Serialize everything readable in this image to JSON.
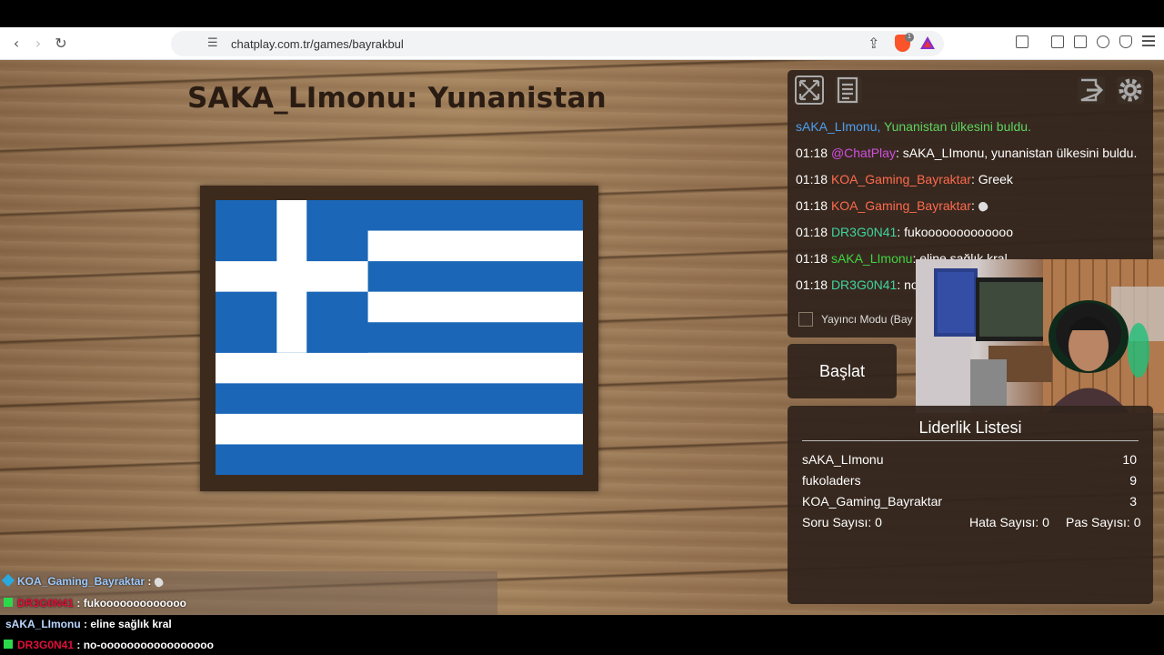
{
  "browser": {
    "url": "chatplay.com.tr/games/bayrakbul",
    "brave_badge": "1"
  },
  "game": {
    "title": "SAKA_LImonu: Yunanistan",
    "flag": "greece"
  },
  "chat": {
    "lines": [
      {
        "time": "",
        "user": "sAKA_LImonu,",
        "text": " Yunanistan ülkesini buldu.",
        "user_color": "#4a9ff0",
        "text_color": "#5fd45f"
      },
      {
        "time": "01:18 ",
        "user": "@ChatPlay",
        "text": ": sAKA_LImonu, yunanistan ülkesini buldu.",
        "user_color": "#d14fe0",
        "text_color": "#ffffff"
      },
      {
        "time": "01:18 ",
        "user": "KOA_Gaming_Bayraktar",
        "text": ": Greek",
        "user_color": "#ff6a4d",
        "text_color": "#ffffff"
      },
      {
        "time": "01:18 ",
        "user": "KOA_Gaming_Bayraktar",
        "text": ": ",
        "user_color": "#ff6a4d",
        "text_color": "#ffffff"
      },
      {
        "time": "01:18 ",
        "user": "DR3G0N41",
        "text": ": fukooooooooooooo",
        "user_color": "#3fd4a0",
        "text_color": "#ffffff"
      },
      {
        "time": "01:18 ",
        "user": "sAKA_LImonu",
        "text": ": eline sağlık kral",
        "user_color": "#3fd43f",
        "text_color": "#ffffff"
      },
      {
        "time": "01:18 ",
        "user": "DR3G0N41",
        "text": ": no-",
        "user_color": "#3fd4a0",
        "text_color": "#ffffff"
      }
    ],
    "streamer_mode_label": "Yayıncı Modu (Bay"
  },
  "controls": {
    "start_label": "Başlat"
  },
  "leaderboard": {
    "title": "Liderlik Listesi",
    "entries": [
      {
        "name": "sAKA_LImonu",
        "score": "10"
      },
      {
        "name": "fukoladers",
        "score": "9"
      },
      {
        "name": "KOA_Gaming_Bayraktar",
        "score": "3"
      }
    ],
    "question_count": "Soru Sayısı: 0",
    "error_count": "Hata Sayısı: 0",
    "pass_count": "Pas Sayısı: 0"
  },
  "overlay": {
    "lines": [
      {
        "user": "KOA_Gaming_Bayraktar",
        "sep": " : ",
        "text": "",
        "user_color": "#9ecbff",
        "gem": "#2aa8e0"
      },
      {
        "user": "DR3G0N41",
        "sep": " : ",
        "text": "fukooooooooooooo",
        "user_color": "#e0103a",
        "gem": "#2bd94b"
      },
      {
        "user": "sAKA_LImonu",
        "sep": " : ",
        "text": "eline sağlık kral",
        "user_color": "#b9d6ff",
        "gem": ""
      },
      {
        "user": "DR3G0N41",
        "sep": " : ",
        "text": "no-ooooooooooooooooo",
        "user_color": "#e0103a",
        "gem": "#2bd94b"
      }
    ]
  },
  "colors": {
    "panel_bg": "#30241c",
    "flag_blue": "#1b66b7",
    "flag_white": "#ffffff"
  }
}
